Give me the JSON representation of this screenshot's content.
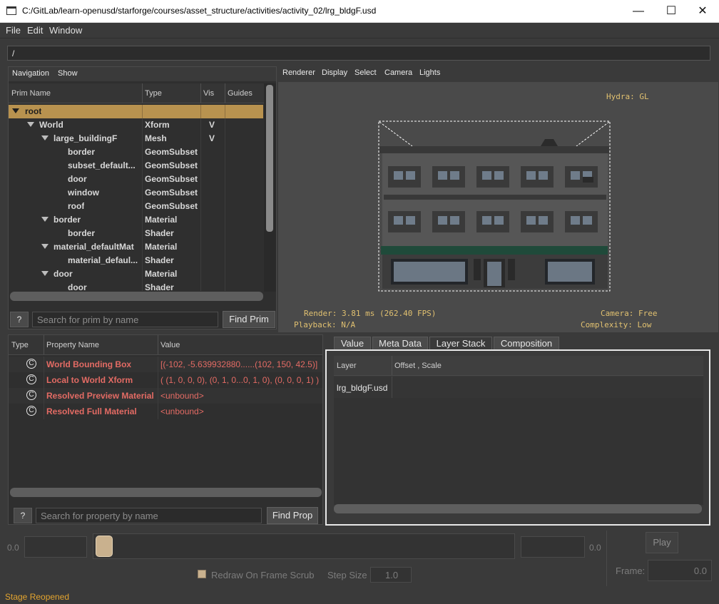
{
  "window": {
    "title": "C:/GitLab/learn-openusd/starforge/courses/asset_structure/activities/activity_02/lrg_bldgF.usd",
    "minimize_glyph": "—",
    "maximize_glyph": "☐",
    "close_glyph": "✕"
  },
  "menubar": {
    "file": "File",
    "edit": "Edit",
    "window": "Window"
  },
  "path_field": {
    "value": "/"
  },
  "navigation": {
    "menu": {
      "navigation": "Navigation",
      "show": "Show"
    },
    "columns": {
      "name": "Prim Name",
      "type": "Type",
      "vis": "Vis",
      "guides": "Guides"
    },
    "rows": [
      {
        "name": "root",
        "type": "",
        "vis": "",
        "expanded": true
      },
      {
        "name": "World",
        "type": "Xform",
        "vis": "V",
        "expanded": true
      },
      {
        "name": "large_buildingF",
        "type": "Mesh",
        "vis": "V",
        "expanded": true
      },
      {
        "name": "border",
        "type": "GeomSubset",
        "vis": ""
      },
      {
        "name": "subset_default...",
        "type": "GeomSubset",
        "vis": ""
      },
      {
        "name": "door",
        "type": "GeomSubset",
        "vis": ""
      },
      {
        "name": "window",
        "type": "GeomSubset",
        "vis": ""
      },
      {
        "name": "roof",
        "type": "GeomSubset",
        "vis": ""
      },
      {
        "name": "border",
        "type": "Material",
        "vis": "",
        "expanded": true
      },
      {
        "name": "border",
        "type": "Shader",
        "vis": ""
      },
      {
        "name": "material_defaultMat",
        "type": "Material",
        "vis": "",
        "expanded": true
      },
      {
        "name": "material_defaul...",
        "type": "Shader",
        "vis": ""
      },
      {
        "name": "door",
        "type": "Material",
        "vis": "",
        "expanded": true
      },
      {
        "name": "door",
        "type": "Shader",
        "vis": ""
      }
    ],
    "help_label": "?",
    "search_placeholder": "Search for prim by name",
    "find_label": "Find Prim"
  },
  "viewport": {
    "menu": {
      "renderer": "Renderer",
      "display": "Display",
      "select": "Select",
      "camera": "Camera",
      "lights": "Lights"
    },
    "hydra": "Hydra: GL",
    "render_stat": "Render: 3.81 ms (262.40 FPS)",
    "playback": "Playback: N/A",
    "camera": "Camera: Free",
    "complexity": "Complexity: Low"
  },
  "properties": {
    "columns": {
      "type": "Type",
      "name": "Property Name",
      "value": "Value"
    },
    "rows": [
      {
        "icon": "C",
        "name": "World Bounding Box",
        "value": "[(-102, -5.639932880......(102, 150, 42.5)]"
      },
      {
        "icon": "C",
        "name": "Local to World Xform",
        "value": "( (1, 0, 0, 0), (0, 1, 0...0, 1, 0), (0, 0, 0, 1) )"
      },
      {
        "icon": "C",
        "name": "Resolved Preview Material",
        "value": "<unbound>"
      },
      {
        "icon": "C",
        "name": "Resolved Full Material",
        "value": "<unbound>"
      }
    ],
    "help_label": "?",
    "search_placeholder": "Search for property by name",
    "find_label": "Find Prop"
  },
  "inspector": {
    "tabs": [
      "Value",
      "Meta Data",
      "Layer Stack",
      "Composition"
    ],
    "active_tab": "Layer Stack",
    "columns": {
      "layer": "Layer",
      "offset": "Offset , Scale"
    },
    "rows": [
      {
        "layer": "lrg_bldgF.usd",
        "offset": ""
      }
    ]
  },
  "timeline": {
    "start_value": "0.0",
    "end_value": "0.0",
    "play_label": "Play",
    "redraw_label": "Redraw On Frame Scrub",
    "step_label": "Step Size",
    "step_value": "1.0",
    "frame_label": "Frame:",
    "frame_value": "0.0"
  },
  "status": {
    "message": "Stage Reopened"
  },
  "colors": {
    "accent_row": "#b8924f",
    "property_red": "#e36b64",
    "hud_text": "#e0c070",
    "status": "#e3a42f"
  }
}
